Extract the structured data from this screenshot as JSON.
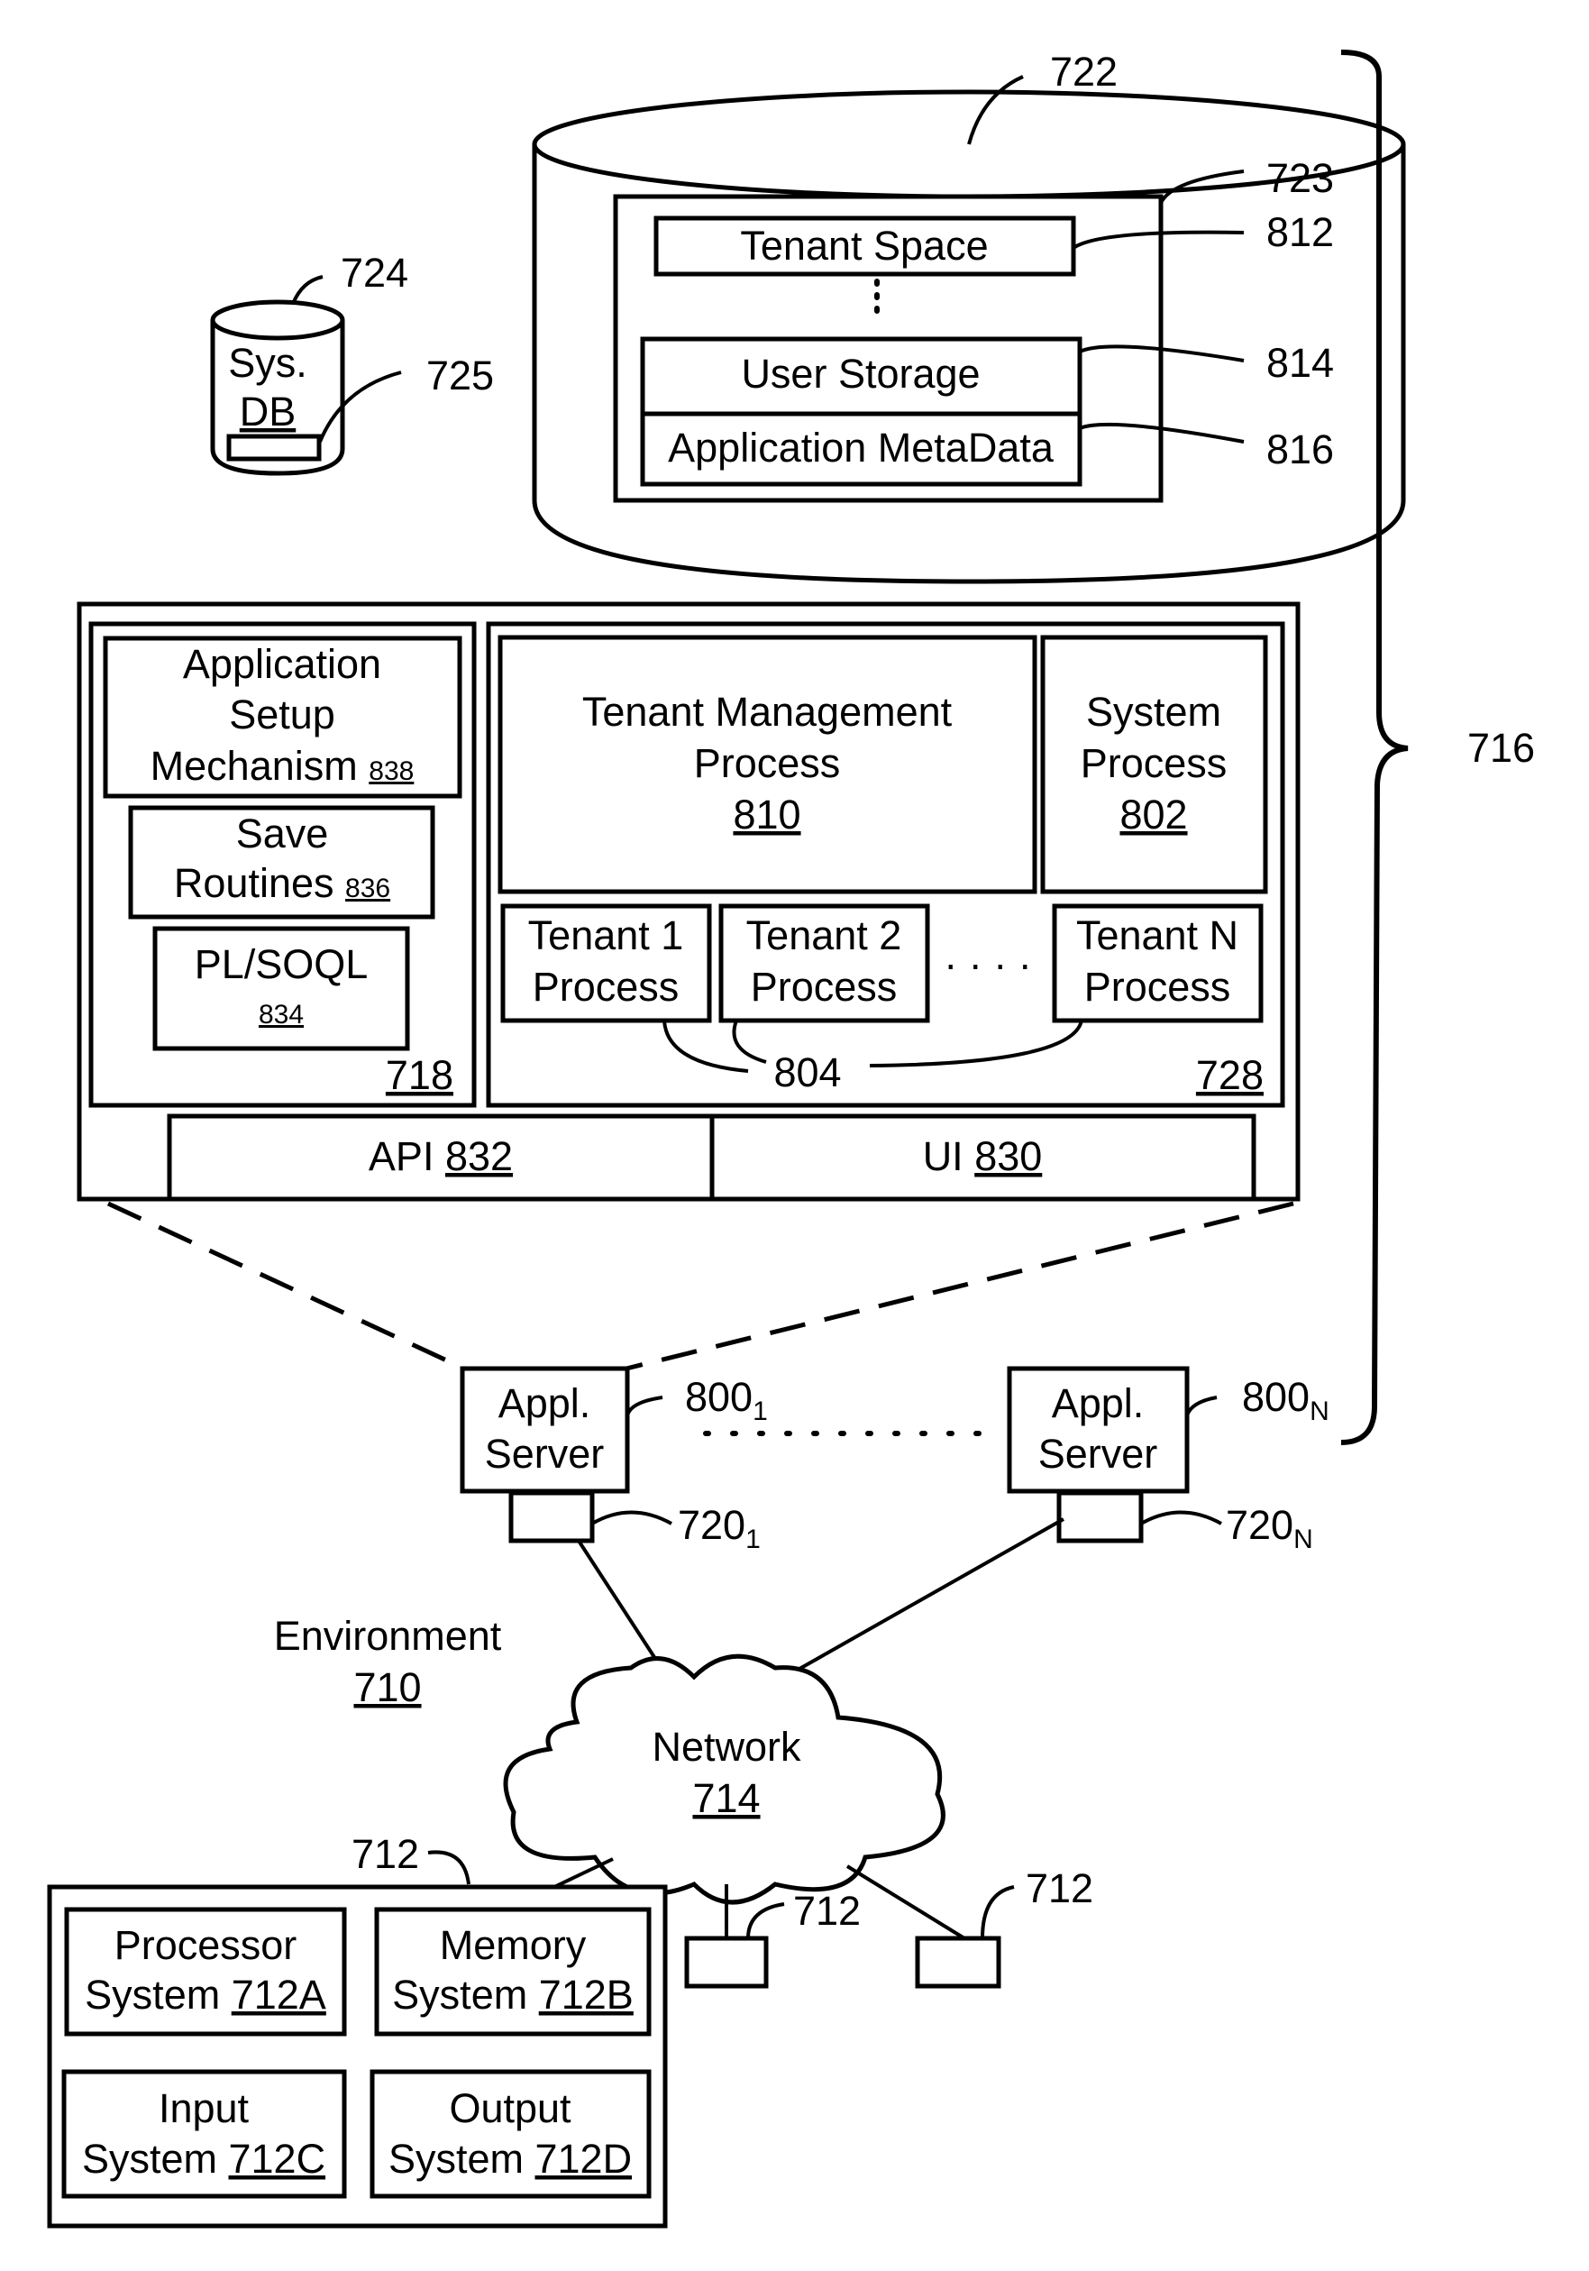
{
  "figure": {
    "bracket_ref": "716",
    "tenant_db": {
      "ref": "722",
      "inner_ref": "723",
      "tenant_space": {
        "label": "Tenant Space",
        "ref": "812"
      },
      "user_storage": {
        "label": "User Storage",
        "ref": "814"
      },
      "app_metadata": {
        "label": "Application MetaData",
        "ref": "816"
      }
    },
    "sys_db": {
      "line1": "Sys.",
      "line2": "DB",
      "ref": "724",
      "inner_ref": "725"
    },
    "app_platform": {
      "ref": "718",
      "setup": {
        "line1": "Application",
        "line2": "Setup",
        "line3": "Mechanism",
        "ref": "838"
      },
      "save": {
        "line1": "Save",
        "line2": "Routines",
        "ref": "836"
      },
      "plsoql": {
        "line1": "PL/SOQL",
        "ref": "834"
      }
    },
    "process_space": {
      "ref": "728",
      "tenant_mgmt": {
        "line1": "Tenant Management",
        "line2": "Process",
        "ref": "810"
      },
      "system_process": {
        "line1": "System",
        "line2": "Process",
        "ref": "802"
      },
      "tenant_processes": [
        {
          "line1": "Tenant 1",
          "line2": "Process"
        },
        {
          "line1": "Tenant 2",
          "line2": "Process"
        },
        {
          "line1": "Tenant N",
          "line2": "Process"
        }
      ],
      "tenant_processes_ref": "804",
      "ellipsis": "· · · ·"
    },
    "api": {
      "label": "API",
      "ref": "832"
    },
    "ui": {
      "label": "UI",
      "ref": "830"
    },
    "servers": [
      {
        "line1": "Appl.",
        "line2": "Server",
        "ref": "800",
        "ref_sub": "1",
        "port_ref": "720",
        "port_sub": "1"
      },
      {
        "line1": "Appl.",
        "line2": "Server",
        "ref": "800",
        "ref_sub": "N",
        "port_ref": "720",
        "port_sub": "N"
      }
    ],
    "environment": {
      "label": "Environment",
      "ref": "710"
    },
    "network": {
      "label": "Network",
      "ref": "714"
    },
    "user_system": {
      "ref": "712",
      "processor": {
        "line1": "Processor",
        "line2": "System",
        "ref": "712A"
      },
      "memory": {
        "line1": "Memory",
        "line2": "System",
        "ref": "712B"
      },
      "input": {
        "line1": "Input",
        "line2": "System",
        "ref": "712C"
      },
      "output": {
        "line1": "Output",
        "line2": "System",
        "ref": "712D"
      }
    },
    "other_user_systems": [
      {
        "ref": "712"
      },
      {
        "ref": "712"
      }
    ]
  }
}
